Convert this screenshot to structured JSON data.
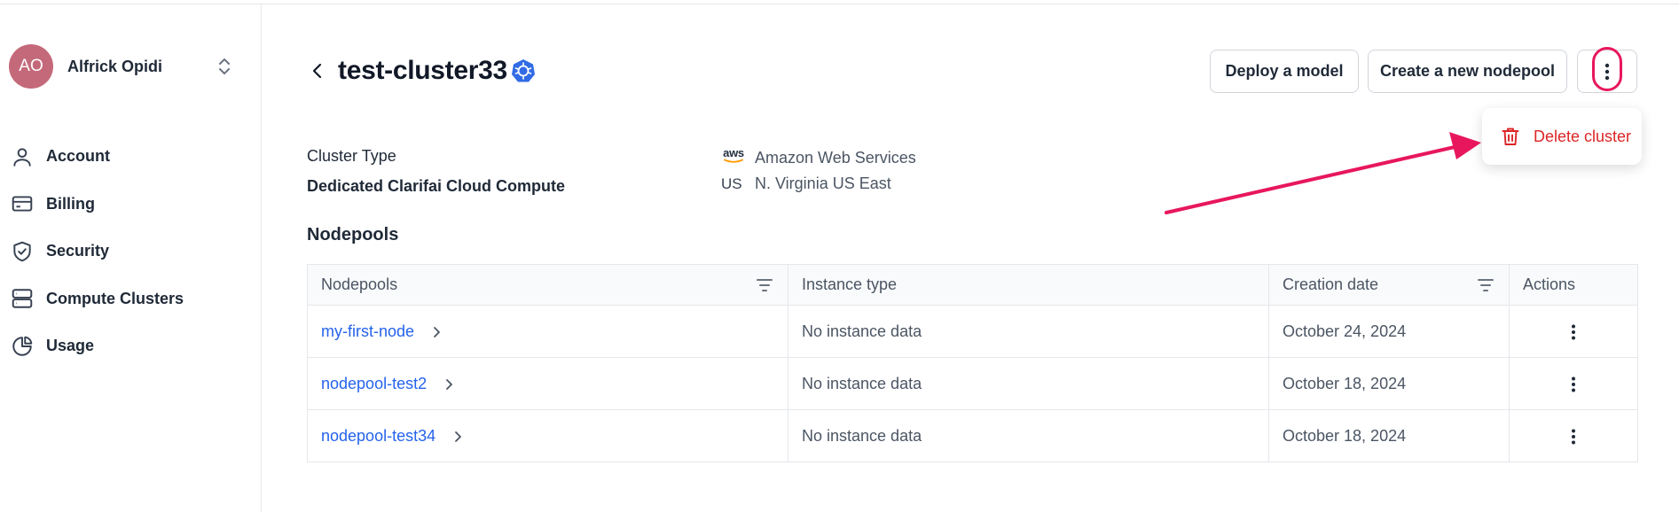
{
  "user": {
    "initials": "AO",
    "name": "Alfrick Opidi"
  },
  "sidebar": {
    "items": [
      {
        "label": "Account",
        "icon": "user-icon"
      },
      {
        "label": "Billing",
        "icon": "credit-card-icon"
      },
      {
        "label": "Security",
        "icon": "shield-icon"
      },
      {
        "label": "Compute Clusters",
        "icon": "server-icon"
      },
      {
        "label": "Usage",
        "icon": "pie-chart-icon"
      }
    ]
  },
  "header": {
    "title": "test-cluster33",
    "deploy_label": "Deploy a model",
    "create_nodepool_label": "Create a new nodepool"
  },
  "menu": {
    "delete_label": "Delete cluster"
  },
  "info": {
    "cluster_type_label": "Cluster Type",
    "cluster_type_value": "Dedicated Clarifai Cloud Compute",
    "provider_logo_text": "aws",
    "provider": "Amazon Web Services",
    "region_code": "US",
    "region": "N. Virginia US East"
  },
  "nodepools": {
    "title": "Nodepools",
    "columns": [
      "Nodepools",
      "Instance type",
      "Creation date",
      "Actions"
    ],
    "rows": [
      {
        "name": "my-first-node",
        "instance": "No instance data",
        "created": "October 24, 2024"
      },
      {
        "name": "nodepool-test2",
        "instance": "No instance data",
        "created": "October 18, 2024"
      },
      {
        "name": "nodepool-test34",
        "instance": "No instance data",
        "created": "October 18, 2024"
      }
    ]
  },
  "colors": {
    "accent": "#2563eb",
    "danger": "#dc2626",
    "annotation": "#e8175d",
    "avatar": "#c4697a"
  }
}
